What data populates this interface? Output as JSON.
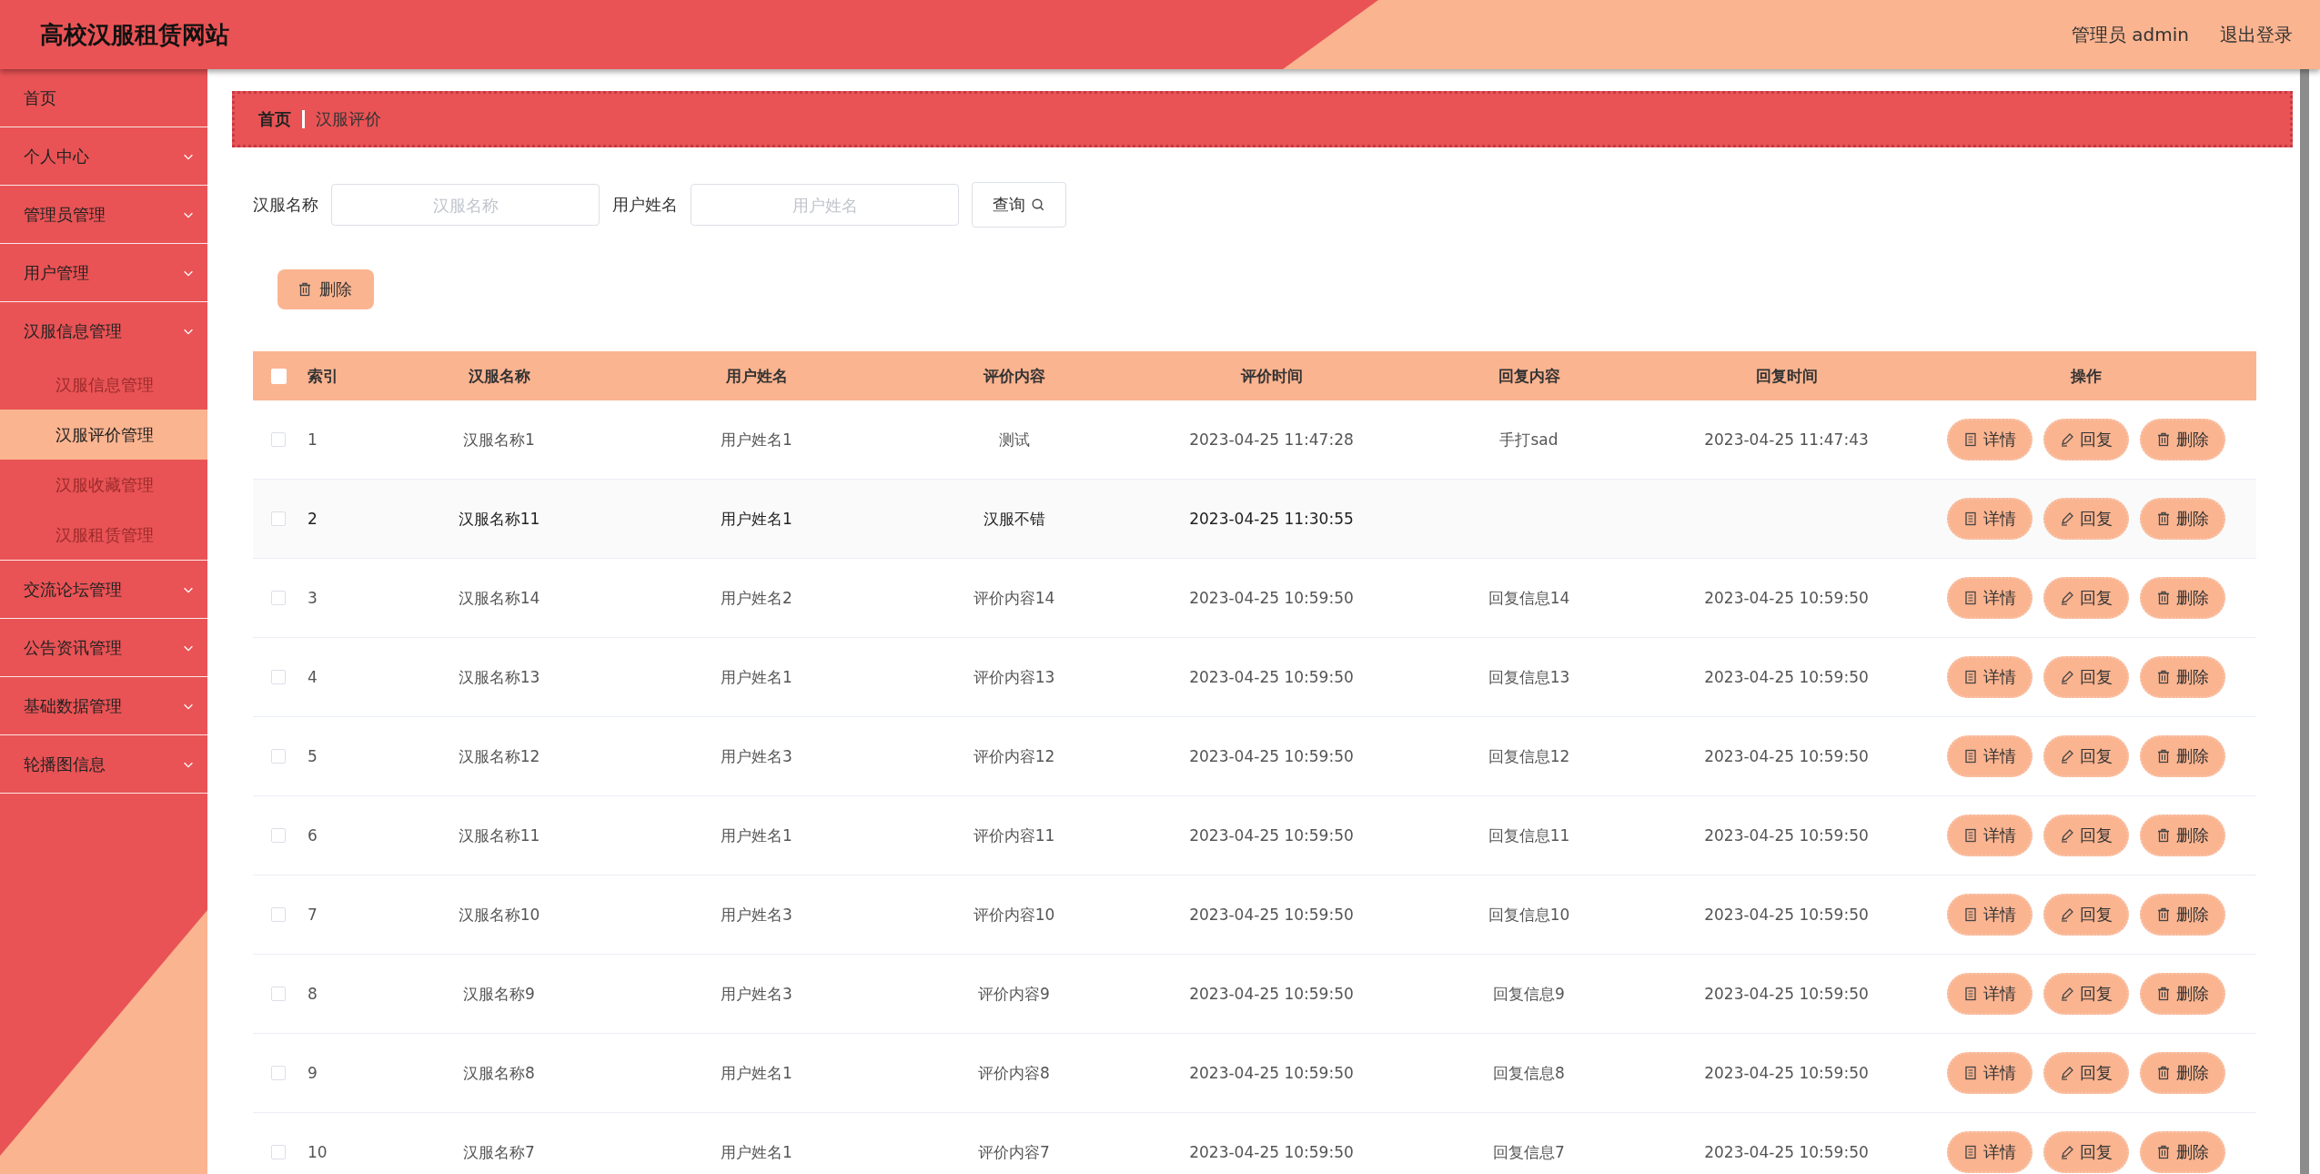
{
  "header": {
    "title": "高校汉服租赁网站",
    "user": "管理员 admin",
    "logout": "退出登录"
  },
  "sidebar": {
    "items": [
      {
        "kind": "link",
        "label": "首页"
      },
      {
        "kind": "menu",
        "label": "个人中心"
      },
      {
        "kind": "menu",
        "label": "管理员管理"
      },
      {
        "kind": "menu",
        "label": "用户管理"
      },
      {
        "kind": "menu",
        "label": "汉服信息管理",
        "expanded": true,
        "children": [
          {
            "label": "汉服信息管理",
            "selected": false
          },
          {
            "label": "汉服评价管理",
            "selected": true
          },
          {
            "label": "汉服收藏管理",
            "selected": false
          },
          {
            "label": "汉服租赁管理",
            "selected": false
          }
        ]
      },
      {
        "kind": "menu",
        "label": "交流论坛管理"
      },
      {
        "kind": "menu",
        "label": "公告资讯管理"
      },
      {
        "kind": "menu",
        "label": "基础数据管理"
      },
      {
        "kind": "menu",
        "label": "轮播图信息"
      }
    ]
  },
  "breadcrumb": [
    "首页",
    "汉服评价"
  ],
  "search": {
    "fields": [
      {
        "label": "汉服名称",
        "placeholder": "汉服名称"
      },
      {
        "label": "用户姓名",
        "placeholder": "用户姓名"
      }
    ],
    "button": "查询"
  },
  "batch_delete": "删除",
  "table": {
    "select_all": false,
    "columns": [
      "索引",
      "汉服名称",
      "用户姓名",
      "评价内容",
      "评价时间",
      "回复内容",
      "回复时间",
      "操作"
    ],
    "rows": [
      {
        "checked": false,
        "highlighted": false,
        "index": "1",
        "name": "汉服名称1",
        "user": "用户姓名1",
        "content": "测试",
        "time": "2023-04-25 11:47:28",
        "reply": "手打sad",
        "reply_time": "2023-04-25 11:47:43",
        "actions": [
          {
            "kind": "detail",
            "label": "详情"
          },
          {
            "kind": "reply",
            "label": "回复"
          },
          {
            "kind": "delete",
            "label": "删除"
          }
        ]
      },
      {
        "checked": false,
        "highlighted": true,
        "index": "2",
        "name": "汉服名称11",
        "user": "用户姓名1",
        "content": "汉服不错",
        "time": "2023-04-25 11:30:55",
        "actions": [
          {
            "kind": "detail",
            "label": "详情"
          },
          {
            "kind": "reply",
            "label": "回复"
          },
          {
            "kind": "delete",
            "label": "删除"
          }
        ]
      },
      {
        "checked": false,
        "highlighted": false,
        "index": "3",
        "name": "汉服名称14",
        "user": "用户姓名2",
        "content": "评价内容14",
        "time": "2023-04-25 10:59:50",
        "reply": "回复信息14",
        "reply_time": "2023-04-25 10:59:50",
        "actions": [
          {
            "kind": "detail",
            "label": "详情"
          },
          {
            "kind": "reply",
            "label": "回复"
          },
          {
            "kind": "delete",
            "label": "删除"
          }
        ]
      },
      {
        "checked": false,
        "highlighted": false,
        "index": "4",
        "name": "汉服名称13",
        "user": "用户姓名1",
        "content": "评价内容13",
        "time": "2023-04-25 10:59:50",
        "reply": "回复信息13",
        "reply_time": "2023-04-25 10:59:50",
        "actions": [
          {
            "kind": "detail",
            "label": "详情"
          },
          {
            "kind": "reply",
            "label": "回复"
          },
          {
            "kind": "delete",
            "label": "删除"
          }
        ]
      },
      {
        "checked": false,
        "highlighted": false,
        "index": "5",
        "name": "汉服名称12",
        "user": "用户姓名3",
        "content": "评价内容12",
        "time": "2023-04-25 10:59:50",
        "reply": "回复信息12",
        "reply_time": "2023-04-25 10:59:50",
        "actions": [
          {
            "kind": "detail",
            "label": "详情"
          },
          {
            "kind": "reply",
            "label": "回复"
          },
          {
            "kind": "delete",
            "label": "删除"
          }
        ]
      },
      {
        "checked": false,
        "highlighted": false,
        "index": "6",
        "name": "汉服名称11",
        "user": "用户姓名1",
        "content": "评价内容11",
        "time": "2023-04-25 10:59:50",
        "reply": "回复信息11",
        "reply_time": "2023-04-25 10:59:50",
        "actions": [
          {
            "kind": "detail",
            "label": "详情"
          },
          {
            "kind": "reply",
            "label": "回复"
          },
          {
            "kind": "delete",
            "label": "删除"
          }
        ]
      },
      {
        "checked": false,
        "highlighted": false,
        "index": "7",
        "name": "汉服名称10",
        "user": "用户姓名3",
        "content": "评价内容10",
        "time": "2023-04-25 10:59:50",
        "reply": "回复信息10",
        "reply_time": "2023-04-25 10:59:50",
        "actions": [
          {
            "kind": "detail",
            "label": "详情"
          },
          {
            "kind": "reply",
            "label": "回复"
          },
          {
            "kind": "delete",
            "label": "删除"
          }
        ]
      },
      {
        "checked": false,
        "highlighted": false,
        "index": "8",
        "name": "汉服名称9",
        "user": "用户姓名3",
        "content": "评价内容9",
        "time": "2023-04-25 10:59:50",
        "reply": "回复信息9",
        "reply_time": "2023-04-25 10:59:50",
        "actions": [
          {
            "kind": "detail",
            "label": "详情"
          },
          {
            "kind": "reply",
            "label": "回复"
          },
          {
            "kind": "delete",
            "label": "删除"
          }
        ]
      },
      {
        "checked": false,
        "highlighted": false,
        "index": "9",
        "name": "汉服名称8",
        "user": "用户姓名1",
        "content": "评价内容8",
        "time": "2023-04-25 10:59:50",
        "reply": "回复信息8",
        "reply_time": "2023-04-25 10:59:50",
        "actions": [
          {
            "kind": "detail",
            "label": "详情"
          },
          {
            "kind": "reply",
            "label": "回复"
          },
          {
            "kind": "delete",
            "label": "删除"
          }
        ]
      },
      {
        "checked": false,
        "highlighted": false,
        "index": "10",
        "name": "汉服名称7",
        "user": "用户姓名1",
        "content": "评价内容7",
        "time": "2023-04-25 10:59:50",
        "reply": "回复信息7",
        "reply_time": "2023-04-25 10:59:50",
        "actions": [
          {
            "kind": "detail",
            "label": "详情"
          },
          {
            "kind": "reply",
            "label": "回复"
          },
          {
            "kind": "delete",
            "label": "删除"
          }
        ]
      }
    ]
  }
}
